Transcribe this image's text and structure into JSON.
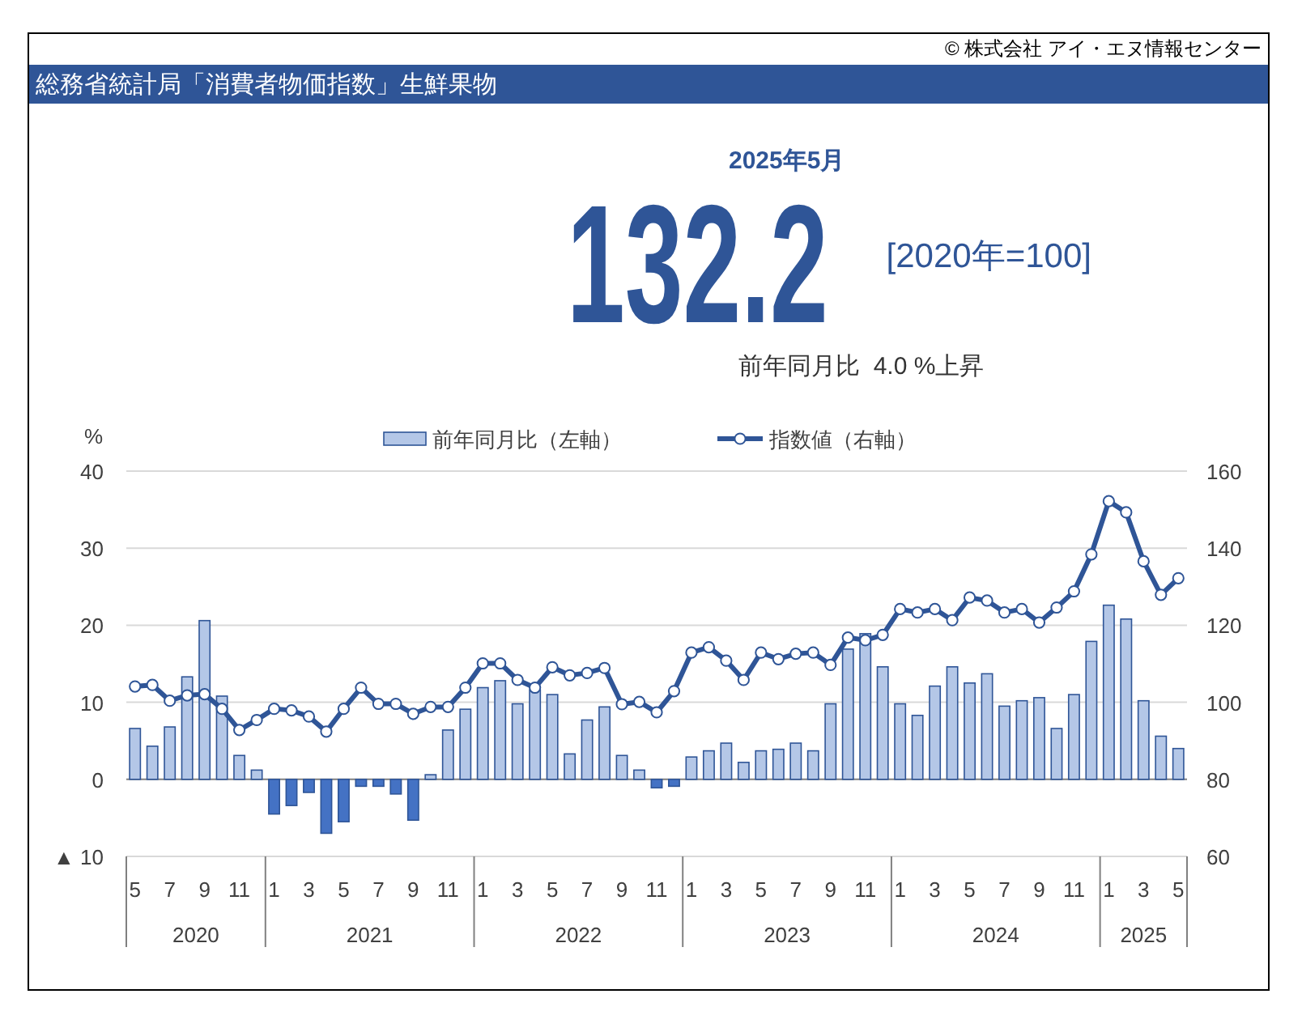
{
  "copyright": "© 株式会社 アイ・エヌ情報センター",
  "header": {
    "title": "総務省統計局「消費者物価指数」生鮮果物"
  },
  "summary": {
    "period": "2025年5月",
    "value": "132.2",
    "base": "[2020年=100]",
    "change": "前年同月比  4.0 %上昇"
  },
  "bar_chart": {
    "chart_data": {
      "type": "bar",
      "ylabel": "%",
      "ylim": [
        -10,
        40
      ],
      "grid": true,
      "yticks": [
        {
          "value": -10,
          "label": "▲ 10"
        },
        0,
        10,
        20,
        30,
        40
      ],
      "categories": [
        "5",
        null,
        "7",
        null,
        "9",
        null,
        "11",
        null,
        "1",
        null,
        "3",
        null,
        "5",
        null,
        "7",
        null,
        "9",
        null,
        "11",
        null,
        "1",
        null,
        "3",
        null,
        "5",
        null,
        "7",
        null,
        "9",
        null,
        "11",
        null,
        "1",
        null,
        "3",
        null,
        "5",
        null,
        "7",
        null,
        "9",
        null,
        "11",
        null,
        "1",
        null,
        "3",
        null,
        "5",
        null,
        "7",
        null,
        "9",
        null,
        "11",
        null,
        "1",
        null,
        "3",
        null,
        "5"
      ],
      "annotations": [
        "2020",
        "2021",
        "2022",
        "2023",
        "2024",
        "2025"
      ],
      "series": [
        {
          "name": "前年同月比（左軸）",
          "color": "#b4c7e7",
          "values": [
            6.6,
            4.3,
            6.8,
            13.3,
            20.6,
            10.8,
            3.1,
            1.2,
            null,
            null,
            null,
            null,
            null,
            null,
            null,
            null,
            null,
            0.6,
            6.4,
            9.1,
            11.9,
            12.8,
            9.8,
            11.6,
            11.0,
            3.3,
            7.7,
            9.4,
            3.1,
            1.2,
            null,
            null,
            2.9,
            3.7,
            4.7,
            2.2,
            3.7,
            3.9,
            4.7,
            3.7,
            9.8,
            16.9,
            18.9,
            14.6,
            9.8,
            8.3,
            12.1,
            14.6,
            12.5,
            13.7,
            9.5,
            10.2,
            10.6,
            6.6,
            11.0,
            17.9,
            22.6,
            20.8,
            10.2,
            5.6,
            4.0
          ]
        },
        {
          "color": "#4472c4",
          "values": [
            null,
            null,
            null,
            null,
            null,
            null,
            null,
            null,
            -4.5,
            -3.4,
            -1.7,
            -7.0,
            -5.5,
            -0.9,
            -0.9,
            -1.9,
            -5.3,
            null,
            null,
            null,
            null,
            null,
            null,
            null,
            null,
            null,
            null,
            null,
            null,
            null,
            -1.1,
            -0.9,
            null,
            null,
            null,
            null,
            null,
            null,
            null,
            null,
            null,
            null,
            null,
            null,
            null,
            null,
            null,
            null,
            null,
            null,
            null,
            null,
            null,
            null,
            null,
            null,
            null,
            null,
            null,
            null,
            null
          ]
        }
      ]
    }
  },
  "line_chart": {
    "chart_data": {
      "type": "line",
      "ylim": [
        60,
        160
      ],
      "yticks": [
        60,
        80,
        100,
        120,
        140,
        160
      ],
      "series": [
        {
          "name": "指数値（右軸）",
          "color": "#2f5597",
          "marker": "o",
          "values": [
            104.1,
            104.5,
            100.4,
            101.8,
            102.1,
            98.3,
            92.8,
            95.4,
            98.3,
            97.9,
            96.3,
            92.4,
            98.3,
            103.8,
            99.6,
            99.6,
            97.0,
            98.8,
            98.8,
            103.8,
            110.1,
            110.1,
            105.8,
            103.8,
            109.1,
            107.0,
            107.6,
            108.9,
            99.5,
            100.1,
            97.4,
            102.9,
            112.9,
            114.3,
            110.8,
            105.8,
            112.9,
            111.2,
            112.6,
            112.9,
            109.7,
            116.8,
            116.1,
            117.5,
            124.2,
            123.3,
            124.2,
            121.3,
            127.2,
            126.4,
            123.3,
            124.2,
            120.7,
            124.6,
            128.8,
            138.4,
            152.2,
            149.3,
            136.6,
            127.9,
            132.2
          ]
        }
      ]
    }
  }
}
